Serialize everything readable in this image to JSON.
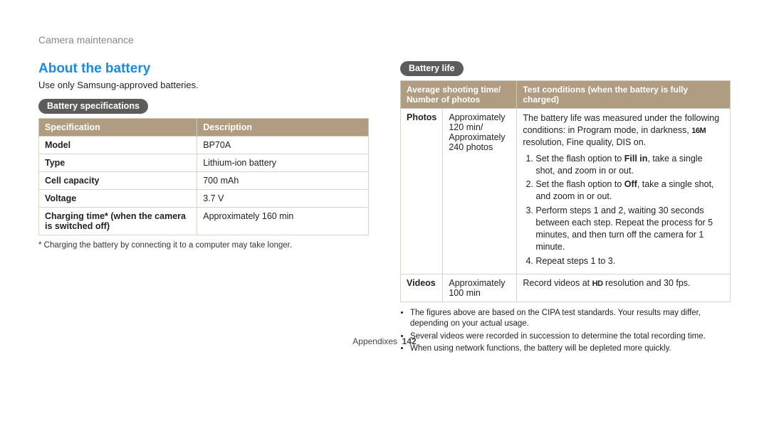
{
  "header": {
    "breadcrumb": "Camera maintenance"
  },
  "section": {
    "title": "About the battery",
    "intro": "Use only Samsung-approved batteries."
  },
  "specs": {
    "pill": "Battery specifications",
    "head_spec": "Specification",
    "head_desc": "Description",
    "rows": [
      {
        "label": "Model",
        "value": "BP70A"
      },
      {
        "label": "Type",
        "value": "Lithium-ion battery"
      },
      {
        "label": "Cell capacity",
        "value": "700 mAh"
      },
      {
        "label": "Voltage",
        "value": "3.7 V"
      },
      {
        "label": "Charging time* (when the camera is switched off)",
        "value": "Approximately 160 min"
      }
    ],
    "footnote": "* Charging the battery by connecting it to a computer may take longer."
  },
  "life": {
    "pill": "Battery life",
    "head_shoot": "Average shooting time/ Number of photos",
    "head_cond": "Test conditions (when the battery is fully charged)",
    "photos": {
      "label": "Photos",
      "shoot": "Approximately 120 min/ Approximately 240 photos",
      "intro_a": "The battery life was measured under the following conditions: in Program mode, in darkness, ",
      "intro_glyph": "16M",
      "intro_b": " resolution, Fine quality, DIS on.",
      "step1_a": "Set the flash option to ",
      "step1_bold": "Fill in",
      "step1_b": ", take a single shot, and zoom in or out.",
      "step2_a": "Set the flash option to ",
      "step2_bold": "Off",
      "step2_b": ", take a single shot, and zoom in or out.",
      "step3": "Perform steps 1 and 2, waiting 30 seconds between each step. Repeat the process for 5 minutes, and then turn off the camera for 1 minute.",
      "step4": "Repeat steps 1 to 3."
    },
    "videos": {
      "label": "Videos",
      "shoot": "Approximately 100 min",
      "cond_a": "Record videos at ",
      "cond_glyph": "HD",
      "cond_b": " resolution and 30 fps."
    },
    "bullets": [
      "The figures above are based on the CIPA test standards. Your results may differ, depending on your actual usage.",
      "Several videos were recorded in succession to determine the total recording time.",
      "When using network functions, the battery will be depleted more quickly."
    ]
  },
  "footer": {
    "section": "Appendixes",
    "page": "142"
  }
}
